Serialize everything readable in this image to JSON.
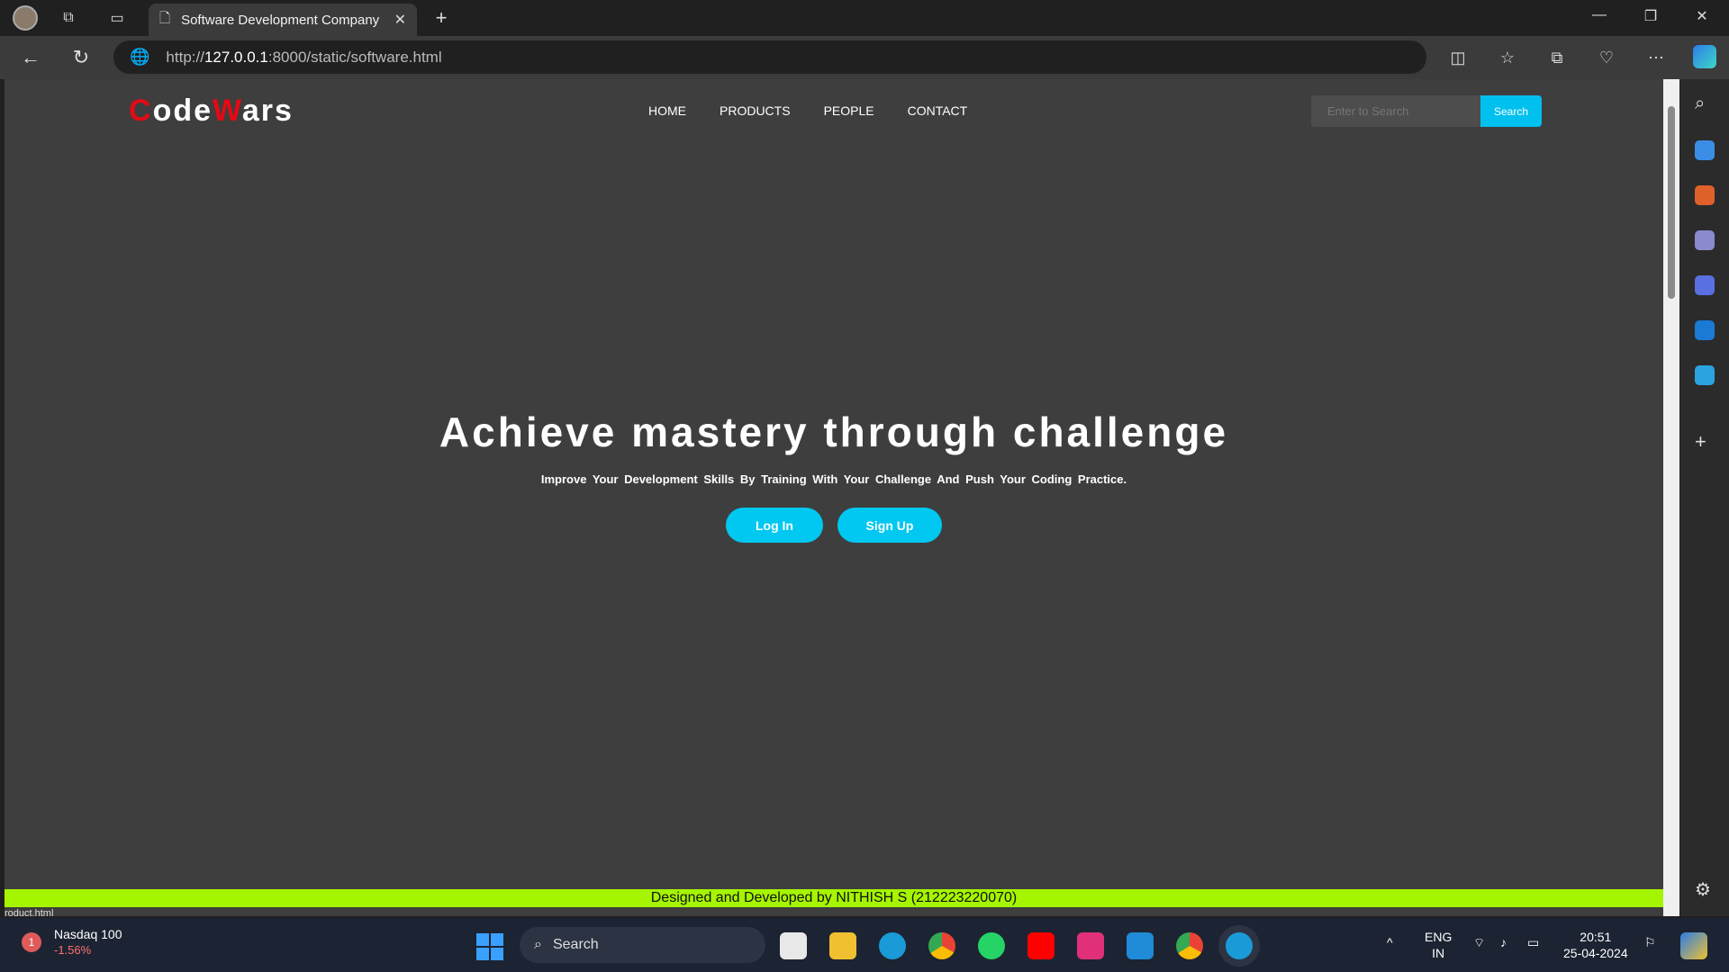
{
  "browser": {
    "tab_title": "Software Development Company",
    "url_prefix": "http://",
    "url_host": "127.0.0.1",
    "url_rest": ":8000/static/software.html"
  },
  "site": {
    "logo": {
      "c1": "C",
      "p1": "ode",
      "c2": "W",
      "p2": "ars"
    },
    "menu": [
      "HOME",
      "PRODUCTS",
      "PEOPLE",
      "CONTACT"
    ],
    "search": {
      "placeholder": "Enter to Search",
      "button": "Search"
    },
    "hero": {
      "title": "Achieve mastery through challenge",
      "subtitle": "Improve Your Development Skills By Training With Your Challenge And Push Your Coding Practice.",
      "login": "Log In",
      "signup": "Sign Up"
    },
    "footer": "Designed and Developed by NITHISH S (212223220070)",
    "status_link": "roduct.html"
  },
  "taskbar": {
    "stock_badge": "1",
    "stock_name": "Nasdaq 100",
    "stock_change": "-1.56%",
    "search_label": "Search",
    "lang_1": "ENG",
    "lang_2": "IN",
    "time": "20:51",
    "date": "25-04-2024"
  },
  "colors": {
    "accent": "#00c8f0",
    "logo_red": "#e50914",
    "footer_green": "#a6f500",
    "page_bg": "#3e3e3e"
  }
}
